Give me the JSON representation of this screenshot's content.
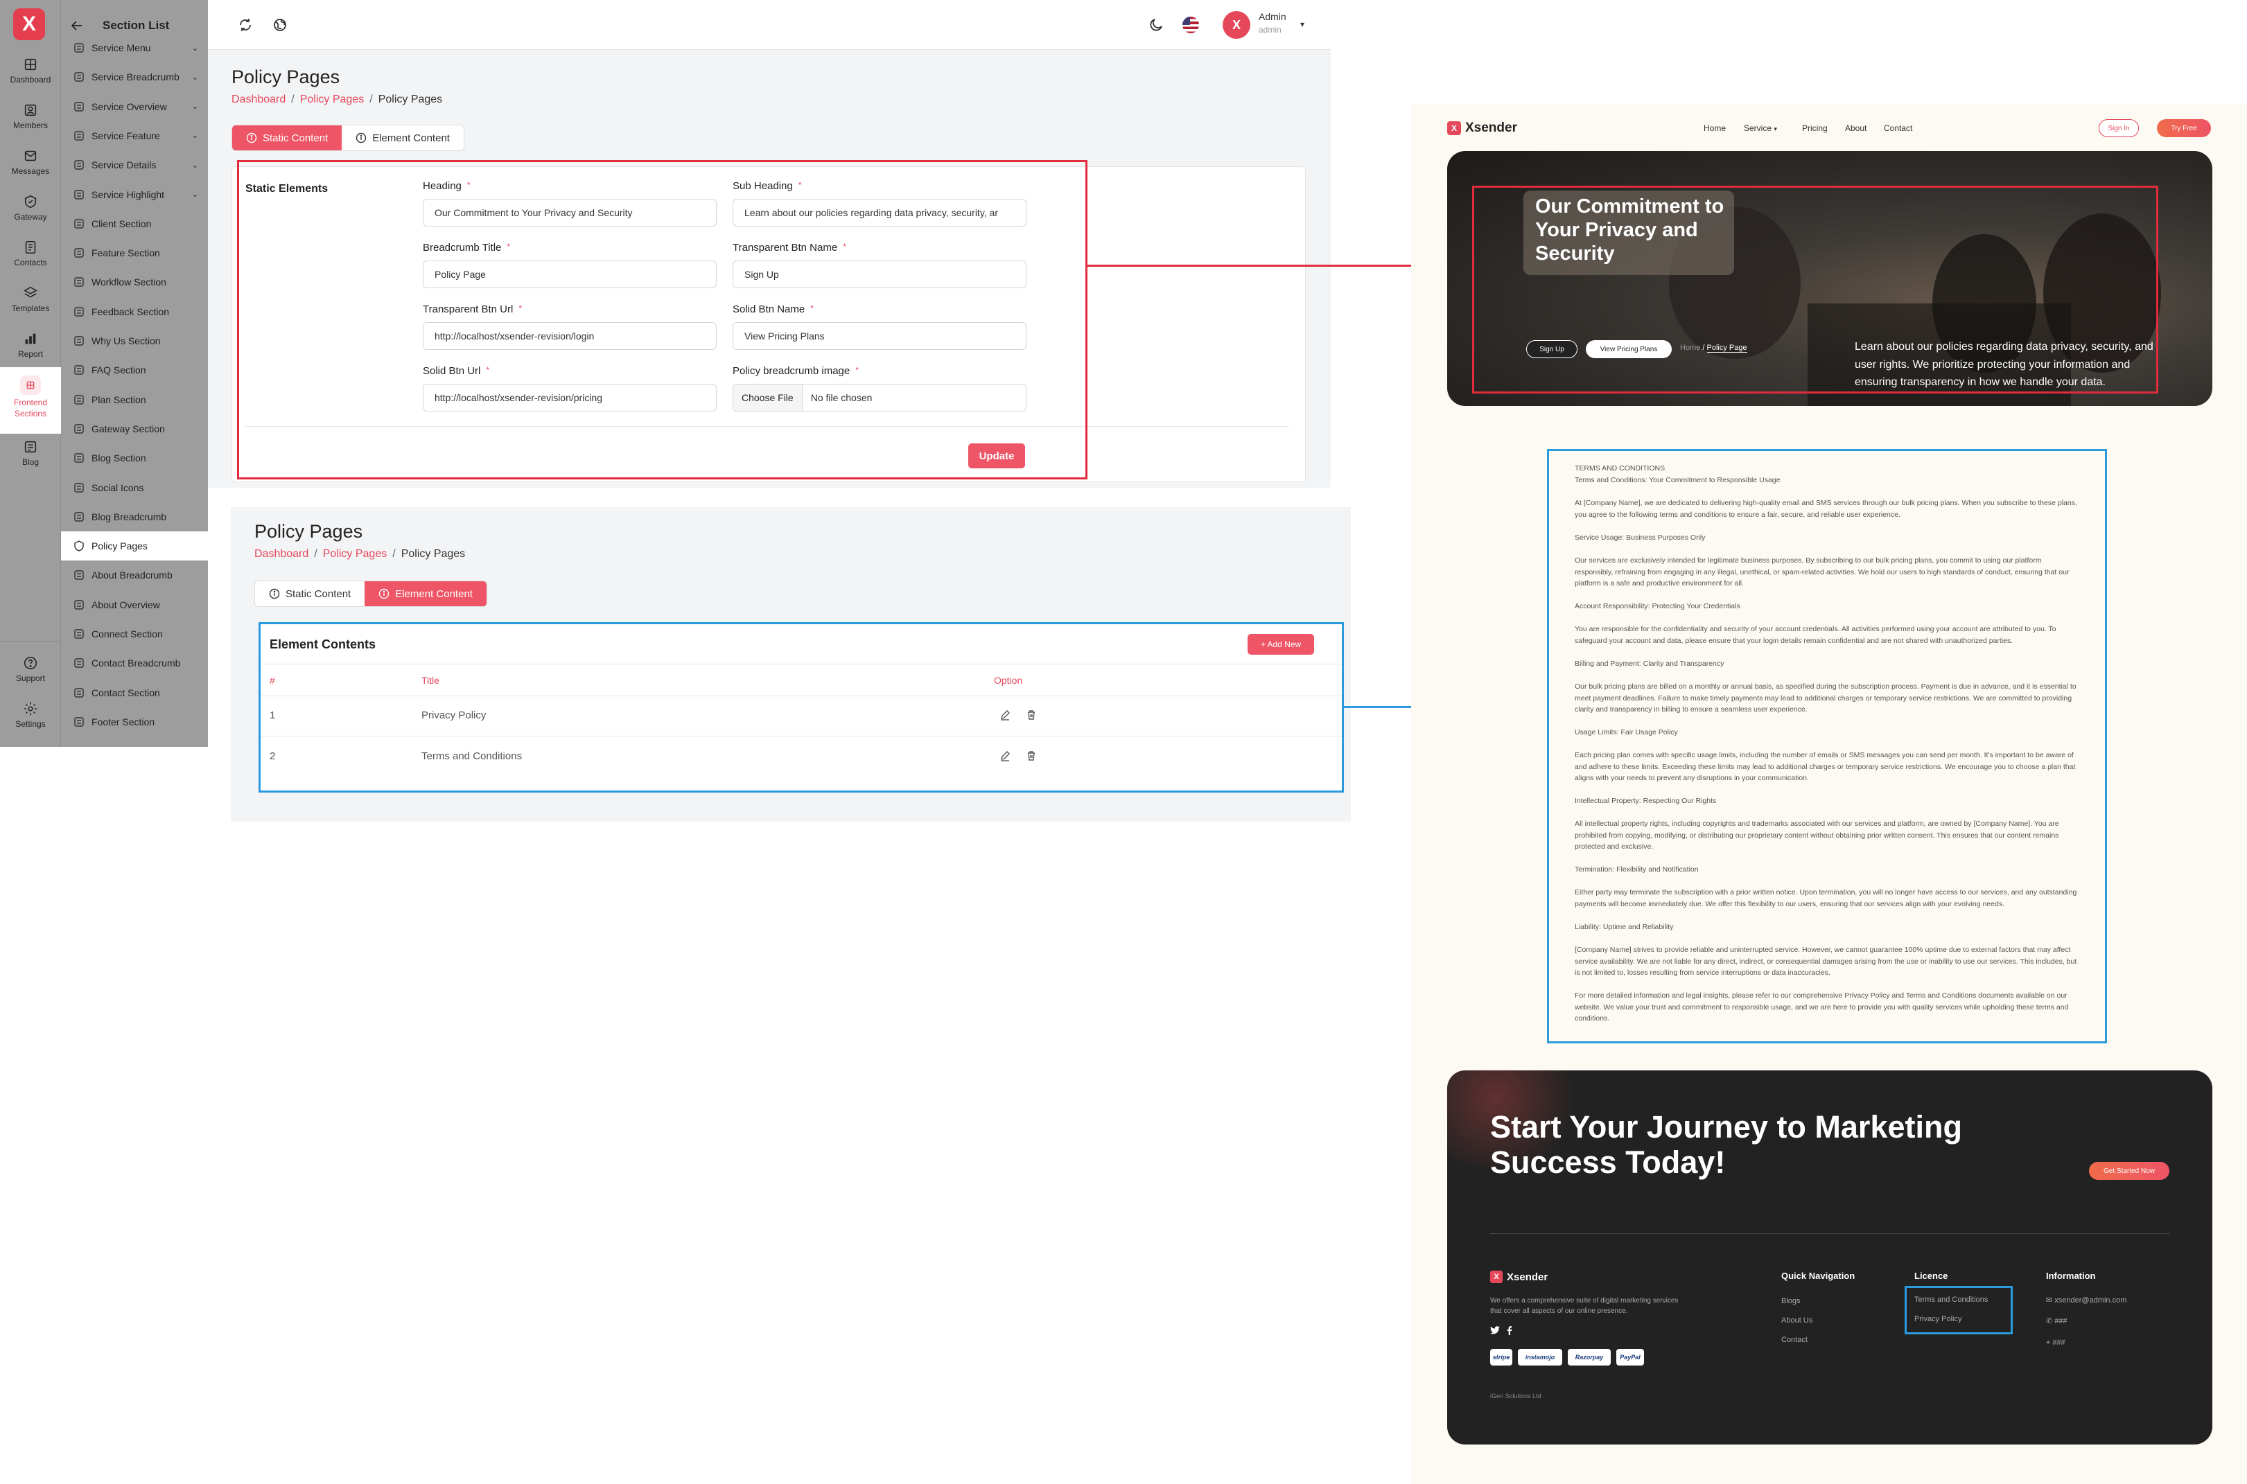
{
  "sidebar": {
    "logo": "X",
    "items": [
      {
        "label": "Dashboard"
      },
      {
        "label": "Members"
      },
      {
        "label": "Messages"
      },
      {
        "label": "Gateway"
      },
      {
        "label": "Contacts"
      },
      {
        "label": "Templates"
      },
      {
        "label": "Report"
      },
      {
        "label": "Frontend Sections"
      },
      {
        "label": "Blog"
      },
      {
        "label": "Support"
      },
      {
        "label": "Settings"
      }
    ]
  },
  "section_list": {
    "title": "Section List",
    "items": [
      {
        "label": "Service Menu"
      },
      {
        "label": "Service Breadcrumb"
      },
      {
        "label": "Service Overview"
      },
      {
        "label": "Service Feature"
      },
      {
        "label": "Service Details"
      },
      {
        "label": "Service Highlight"
      },
      {
        "label": "Client Section"
      },
      {
        "label": "Feature Section"
      },
      {
        "label": "Workflow Section"
      },
      {
        "label": "Feedback Section"
      },
      {
        "label": "Why Us Section"
      },
      {
        "label": "FAQ Section"
      },
      {
        "label": "Plan Section"
      },
      {
        "label": "Gateway Section"
      },
      {
        "label": "Blog Section"
      },
      {
        "label": "Social Icons"
      },
      {
        "label": "Blog Breadcrumb"
      },
      {
        "label": "Policy Pages"
      },
      {
        "label": "About Breadcrumb"
      },
      {
        "label": "About Overview"
      },
      {
        "label": "Connect Section"
      },
      {
        "label": "Contact Breadcrumb"
      },
      {
        "label": "Contact Section"
      },
      {
        "label": "Footer Section"
      }
    ]
  },
  "topbar": {
    "user_name": "Admin",
    "user_role": "admin",
    "avatar": "X"
  },
  "panel1": {
    "title": "Policy Pages",
    "breadcrumb": [
      "Dashboard",
      "Policy Pages",
      "Policy Pages"
    ],
    "tabs": [
      "Static Content",
      "Element Content"
    ],
    "section_title": "Static Elements",
    "fields": {
      "heading": {
        "label": "Heading",
        "value": "Our Commitment to Your Privacy and Security"
      },
      "sub_heading": {
        "label": "Sub Heading",
        "value": "Learn about our policies regarding data privacy, security, ar"
      },
      "breadcrumb_title": {
        "label": "Breadcrumb Title",
        "value": "Policy Page"
      },
      "transparent_btn_name": {
        "label": "Transparent Btn Name",
        "value": "Sign Up"
      },
      "transparent_btn_url": {
        "label": "Transparent Btn Url",
        "value": "http://localhost/xsender-revision/login"
      },
      "solid_btn_name": {
        "label": "Solid Btn Name",
        "value": "View Pricing Plans"
      },
      "solid_btn_url": {
        "label": "Solid Btn Url",
        "value": "http://localhost/xsender-revision/pricing"
      },
      "breadcrumb_image": {
        "label": "Policy breadcrumb image",
        "button": "Choose File",
        "value": "No file chosen"
      }
    },
    "required_mark": "*",
    "update_label": "Update"
  },
  "panel2": {
    "title": "Policy Pages",
    "breadcrumb": [
      "Dashboard",
      "Policy Pages",
      "Policy Pages"
    ],
    "tabs": [
      "Static Content",
      "Element Content"
    ],
    "card_title": "Element Contents",
    "add_label": "+ Add New",
    "columns": [
      "#",
      "Title",
      "Option"
    ],
    "rows": [
      {
        "num": "1",
        "title": "Privacy Policy"
      },
      {
        "num": "2",
        "title": "Terms and Conditions"
      }
    ]
  },
  "site": {
    "brand": "Xsender",
    "nav": [
      "Home",
      "Service",
      "Pricing",
      "About",
      "Contact"
    ],
    "sign_in": "Sign In",
    "try_free": "Try Free",
    "hero_title": "Our Commitment to Your Privacy and Security",
    "hero_text": "Learn about our policies regarding data privacy, security, and user rights. We prioritize protecting your information and ensuring transparency in how we handle your data.",
    "hero_btn1": "Sign Up",
    "hero_btn2": "View Pricing Plans",
    "hero_crumb_home": "Home",
    "hero_crumb_sep": "/",
    "hero_crumb_current": "Policy Page",
    "policy": [
      "TERMS AND CONDITIONS",
      "Terms and Conditions: Your Commitment to Responsible Usage",
      "At [Company Name], we are dedicated to delivering high-quality email and SMS services through our bulk pricing plans. When you subscribe to these plans, you agree to the following terms and conditions to ensure a fair, secure, and reliable user experience.",
      "Service Usage: Business Purposes Only",
      "Our services are exclusively intended for legitimate business purposes. By subscribing to our bulk pricing plans, you commit to using our platform responsibly, refraining from engaging in any illegal, unethical, or spam-related activities. We hold our users to high standards of conduct, ensuring that our platform is a safe and productive environment for all.",
      "Account Responsibility: Protecting Your Credentials",
      "You are responsible for the confidentiality and security of your account credentials. All activities performed using your account are attributed to you. To safeguard your account and data, please ensure that your login details remain confidential and are not shared with unauthorized parties.",
      "Billing and Payment: Clarity and Transparency",
      "Our bulk pricing plans are billed on a monthly or annual basis, as specified during the subscription process. Payment is due in advance, and it is essential to meet payment deadlines. Failure to make timely payments may lead to additional charges or temporary service restrictions. We are committed to providing clarity and transparency in billing to ensure a seamless user experience.",
      "Usage Limits: Fair Usage Policy",
      "Each pricing plan comes with specific usage limits, including the number of emails or SMS messages you can send per month. It's important to be aware of and adhere to these limits. Exceeding these limits may lead to additional charges or temporary service restrictions. We encourage you to choose a plan that aligns with your needs to prevent any disruptions in your communication.",
      "Intellectual Property: Respecting Our Rights",
      "All intellectual property rights, including copyrights and trademarks associated with our services and platform, are owned by [Company Name]. You are prohibited from copying, modifying, or distributing our proprietary content without obtaining prior written consent. This ensures that our content remains protected and exclusive.",
      "Termination: Flexibility and Notification",
      "Either party may terminate the subscription with a prior written notice. Upon termination, you will no longer have access to our services, and any outstanding payments will become immediately due. We offer this flexibility to our users, ensuring that our services align with your evolving needs.",
      "Liability: Uptime and Reliability",
      "[Company Name] strives to provide reliable and uninterrupted service. However, we cannot guarantee 100% uptime due to external factors that may affect service availability. We are not liable for any direct, indirect, or consequential damages arising from the use or inability to use our services. This includes, but is not limited to, losses resulting from service interruptions or data inaccuracies.",
      "For more detailed information and legal insights, please refer to our comprehensive Privacy Policy and Terms and Conditions documents available on our website. We value your trust and commitment to responsible usage, and we are here to provide you with quality services while upholding these terms and conditions."
    ],
    "cta_title": "Start Your Journey to Marketing Success Today!",
    "cta_button": "Get Started Now",
    "footer_brand": "Xsender",
    "footer_desc": "We offers a comprehensive suite of digital marketing services that cover all aspects of our online presence.",
    "quick_nav_title": "Quick Navigation",
    "quick_nav": [
      "Blogs",
      "About Us",
      "Contact"
    ],
    "licence_title": "Licence",
    "licence": [
      "Terms and Conditions",
      "Privacy Policy"
    ],
    "info_title": "Information",
    "info_email": "xsender@admin.com",
    "info_phone": "###",
    "info_address": "###",
    "payments": [
      "stripe",
      "instamojo",
      "Razorpay",
      "PayPal"
    ],
    "copyright": "iGen Solutions Ltd"
  },
  "colors": {
    "accent": "#ee5566",
    "frame_red": "#e02c3c",
    "frame_blue": "#2b9be0"
  }
}
